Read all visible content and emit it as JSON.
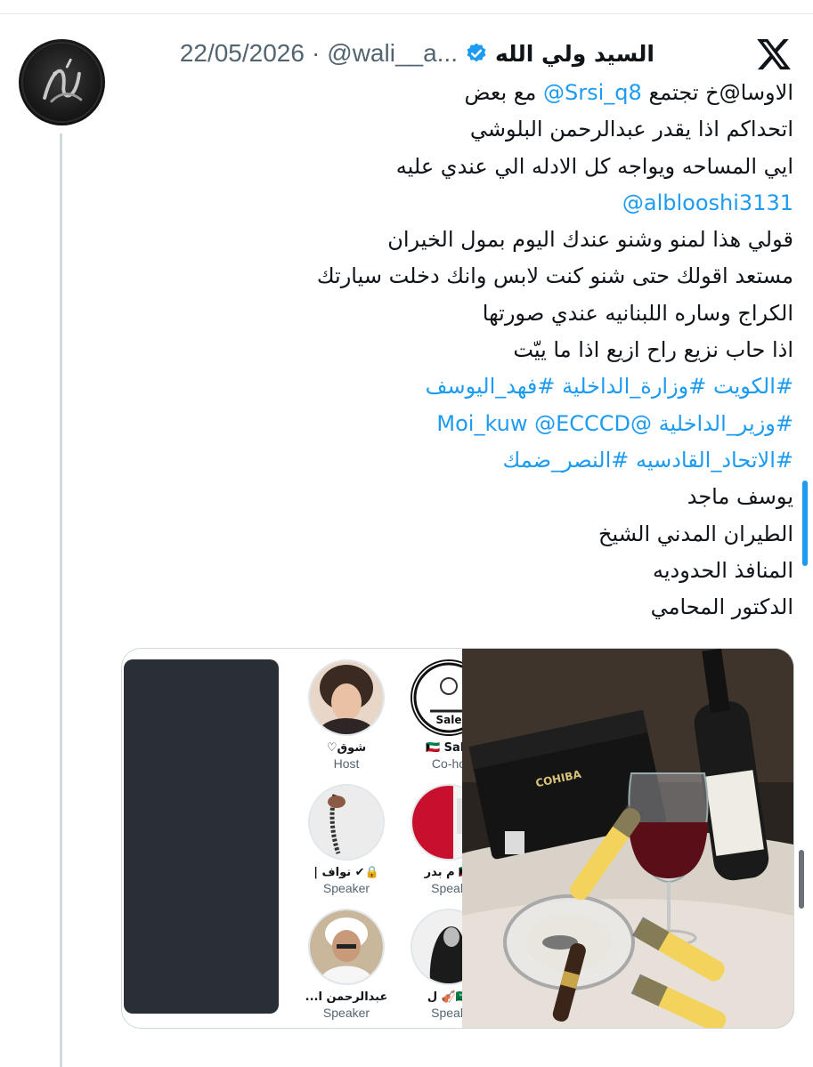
{
  "tweet": {
    "display_name": "السيد ولي الله",
    "handle": "@wali__a...",
    "separator": "·",
    "date": "22/05/2026",
    "avatar_text": "ولي الله",
    "lines": [
      {
        "text": "الاوسا@خ تجتمع ",
        "mention": "@Srsi_q8",
        "rest": " مع بعض"
      },
      {
        "text": "اتحداكم اذا يقدر عبدالرحمن البلوشي"
      },
      {
        "text": "ايي المساحه ويواجه كل الادله الي عندي عليه"
      },
      {
        "link": "@alblooshi3131"
      },
      {
        "text": "قولي هذا لمنو وشنو عندك اليوم بمول الخيران"
      },
      {
        "text": "مستعد اقولك حتى شنو كنت لابس وانك دخلت سيارتك"
      },
      {
        "text": "الكراج وساره اللبنانيه عندي صورتها"
      },
      {
        "text": "اذا حاب نزيع راح ازيع اذا ما ييّت"
      },
      {
        "link": "#الكويت #وزارة_الداخلية #فهد_اليوسف"
      },
      {
        "link": "#وزير_الداخلية @Moi_kuw @ECCCD"
      },
      {
        "link": "#الاتحاد_القادسيه #النصر_ضمك"
      },
      {
        "text": "يوسف ماجد"
      },
      {
        "text": "الطيران المدني الشيخ"
      },
      {
        "text": "المنافذ الحدوديه"
      },
      {
        "text": "الدكتور المحامي"
      }
    ]
  },
  "media": {
    "spaces": [
      {
        "name": "شوق♡",
        "role": "Host"
      },
      {
        "name": "🇰🇼 Sale",
        "role": "Co-ho"
      },
      {
        "name": "🔒✔ نواف |",
        "role": "Speaker"
      },
      {
        "name": "🇰🇼 م بدر",
        "role": "Speak"
      },
      {
        "name": "عبدالرحمن ا...",
        "role": "Speaker"
      },
      {
        "name": "🇸🇦🎻 ل",
        "role": "Speak"
      }
    ],
    "photo_labels": {
      "box": "COHIBA"
    }
  },
  "colors": {
    "link": "#1d9bf0",
    "secondary_text": "#536471",
    "verified": "#1d9bf0"
  },
  "icons": {
    "logo": "x-logo-icon",
    "verified": "verified-badge-icon"
  }
}
